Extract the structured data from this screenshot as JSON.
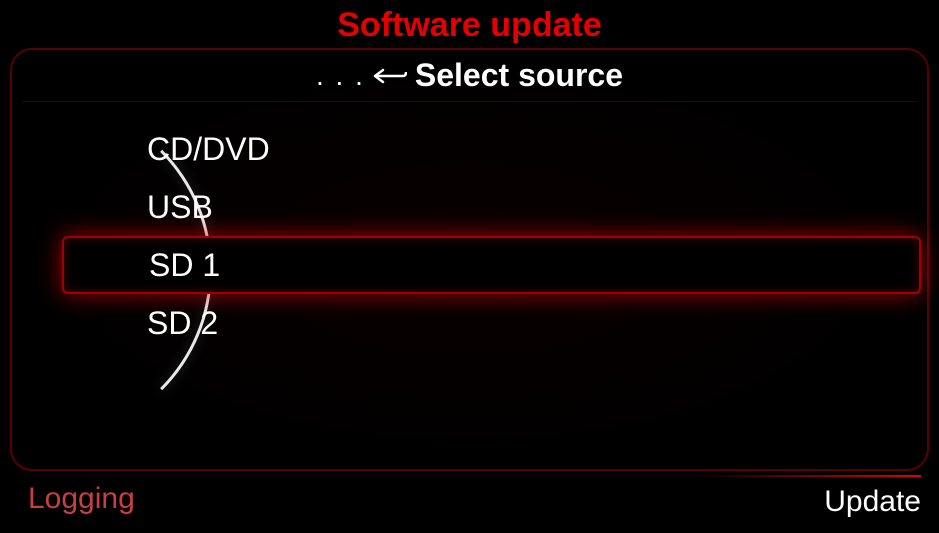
{
  "title": "Software update",
  "subtitle": {
    "dots": ". . .",
    "label": "Select source"
  },
  "sources": {
    "items": [
      {
        "label": "CD/DVD",
        "selected": false
      },
      {
        "label": "USB",
        "selected": false
      },
      {
        "label": "SD 1",
        "selected": true
      },
      {
        "label": "SD 2",
        "selected": false
      }
    ]
  },
  "footer": {
    "left": "Logging",
    "right": "Update"
  }
}
